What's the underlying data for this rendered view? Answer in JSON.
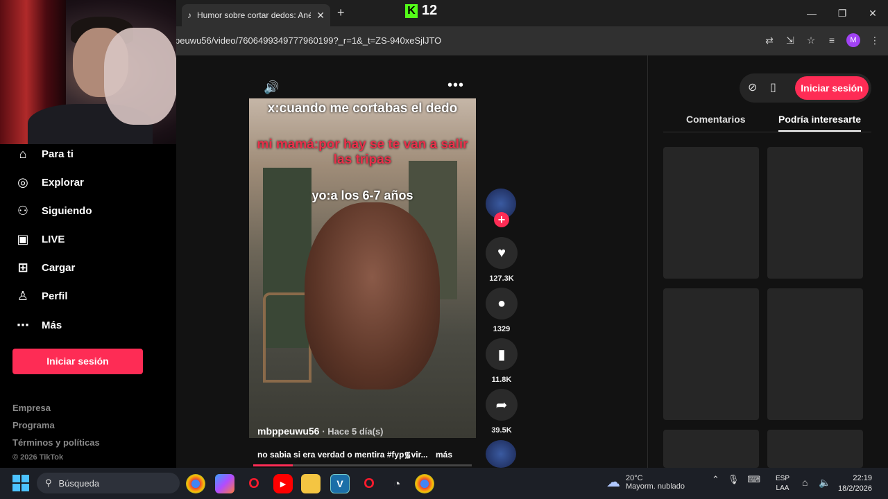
{
  "browser": {
    "tab_title": "Humor sobre cortar dedos: Ané",
    "new_tab": "+",
    "overlay_counter": "12",
    "url": "peuwu56/video/7606499349777960199?_r=1&_t=ZS-940xeSjlJTO",
    "profile_initial": "M",
    "win_minimize": "—",
    "win_restore": "❐",
    "win_close": "✕"
  },
  "sidebar": {
    "items": [
      {
        "label": "Para ti",
        "icon": "home-icon"
      },
      {
        "label": "Explorar",
        "icon": "compass-icon"
      },
      {
        "label": "Siguiendo",
        "icon": "user-follow-icon"
      },
      {
        "label": "LIVE",
        "icon": "live-icon"
      },
      {
        "label": "Cargar",
        "icon": "upload-icon"
      },
      {
        "label": "Perfil",
        "icon": "profile-icon"
      },
      {
        "label": "Más",
        "icon": "more-icon"
      }
    ],
    "login_button": "Iniciar sesión",
    "footer": [
      "Empresa",
      "Programa",
      "Términos y políticas"
    ],
    "copyright": "© 2026 TikTok"
  },
  "video": {
    "captions": {
      "line1": "x:cuando me cortabas el dedo",
      "line2": "mi mamá:por hay se te van a salir las tripas",
      "line3": "yo:a los 6-7 años"
    },
    "author": "mbppeuwu56",
    "posted": "· Hace 5 día(s)",
    "description": "no sabia si era verdad o mentira #fyp᯾vir...",
    "more": "más",
    "progress_fraction": 0.18
  },
  "actions": {
    "likes": "127.3K",
    "comments": "1329",
    "saves": "11.8K",
    "shares": "39.5K"
  },
  "right_panel": {
    "login_button": "Iniciar sesión",
    "tabs": [
      "Comentarios",
      "Podría interesarte"
    ],
    "active_tab": "Podría interesarte"
  },
  "taskbar": {
    "search_placeholder": "Búsqueda",
    "weather_temp": "20°C",
    "weather_desc": "Mayorm. nublado",
    "lang_line1": "ESP",
    "lang_line2": "LAA",
    "time": "22:19",
    "date": "18/2/2026"
  }
}
